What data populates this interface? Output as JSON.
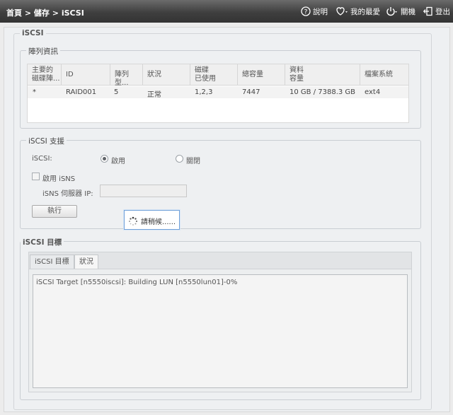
{
  "breadcrumb": {
    "home": "首頁",
    "storage": "儲存",
    "current": "iSCSI",
    "sep": ">"
  },
  "toolbar": {
    "help": "說明",
    "favorites": "我的最愛",
    "shutdown": "關機",
    "logout": "登出"
  },
  "page": {
    "section_title": "iSCSI"
  },
  "raid": {
    "title": "陣列資訊",
    "columns": [
      {
        "line1": "主要的",
        "line2": "磁碟陣..."
      },
      {
        "line1": "ID",
        "line2": ""
      },
      {
        "line1": "陣列型...",
        "line2": ""
      },
      {
        "line1": "狀況",
        "line2": ""
      },
      {
        "line1": "磁碟",
        "line2": "已使用"
      },
      {
        "line1": "總容量",
        "line2": ""
      },
      {
        "line1": "資料",
        "line2": "容量"
      },
      {
        "line1": "檔案系統",
        "line2": ""
      }
    ],
    "rows": [
      {
        "master": "*",
        "id": "RAID001",
        "level": "5",
        "status": "正常",
        "disks": "1,2,3",
        "total": "7447",
        "data": "10 GB / 7388.3 GB",
        "fs": "ext4"
      }
    ]
  },
  "support": {
    "title": "iSCSI 支援",
    "iscsi_label": "iSCSI:",
    "enable_label": "啟用",
    "disable_label": "關閉",
    "isns_enable_label": "啟用 iSNS",
    "isns_server_label": "iSNS 伺服器 IP:",
    "isns_server_value": "",
    "apply_button": "執行"
  },
  "wait": {
    "text": "請稍候......"
  },
  "target": {
    "title": "iSCSI 目標",
    "tabs": [
      {
        "label": "iSCSI 目標"
      },
      {
        "label": "狀況"
      }
    ],
    "log": "iSCSI Target [n5550iscsi]: Building LUN [n5550lun01]-0%"
  }
}
